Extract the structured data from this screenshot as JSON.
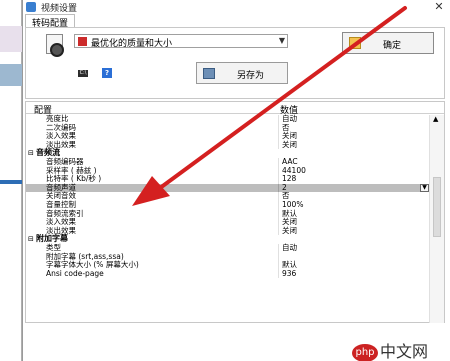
{
  "window": {
    "title": "视频设置",
    "tab": "转码配置"
  },
  "profile": {
    "selected": "最优化的质量和大小",
    "ok_label": "确定",
    "save_as_label": "另存为",
    "cmd_icon": "cmd-icon",
    "help_icon": "help-icon"
  },
  "grid": {
    "header": {
      "property": "配置",
      "value": "数值"
    },
    "rows": [
      {
        "name": "亮度比",
        "value": "自动",
        "type": "prop"
      },
      {
        "name": "二次编码",
        "value": "否",
        "type": "prop"
      },
      {
        "name": "淡入效果",
        "value": "关闭",
        "type": "prop"
      },
      {
        "name": "淡出效果",
        "value": "关闭",
        "type": "prop"
      },
      {
        "name": "音频流",
        "value": "",
        "type": "cat"
      },
      {
        "name": "音频编码器",
        "value": "AAC",
        "type": "prop"
      },
      {
        "name": "采样率 ( 赫兹 )",
        "value": "44100",
        "type": "prop"
      },
      {
        "name": "比特率 ( Kb/秒 )",
        "value": "128",
        "type": "prop"
      },
      {
        "name": "音频声道",
        "value": "2",
        "type": "selected"
      },
      {
        "name": "关闭音效",
        "value": "否",
        "type": "prop"
      },
      {
        "name": "音量控制",
        "value": "100%",
        "type": "prop"
      },
      {
        "name": "音频流索引",
        "value": "默认",
        "type": "prop"
      },
      {
        "name": "淡入效果",
        "value": "关闭",
        "type": "prop"
      },
      {
        "name": "淡出效果",
        "value": "关闭",
        "type": "prop"
      },
      {
        "name": "附加字幕",
        "value": "",
        "type": "cat"
      },
      {
        "name": "类型",
        "value": "自动",
        "type": "prop"
      },
      {
        "name": "附加字幕 (srt,ass,ssa)",
        "value": "",
        "type": "prop"
      },
      {
        "name": "字幕字体大小 (% 屏幕大小)",
        "value": "默认",
        "type": "prop"
      },
      {
        "name": "Ansi code-page",
        "value": "936",
        "type": "prop"
      }
    ]
  },
  "watermark": {
    "logo": "php",
    "text": "中文网"
  },
  "colors": {
    "arrow": "#d42020",
    "selected_row": "#bdbdbd"
  }
}
